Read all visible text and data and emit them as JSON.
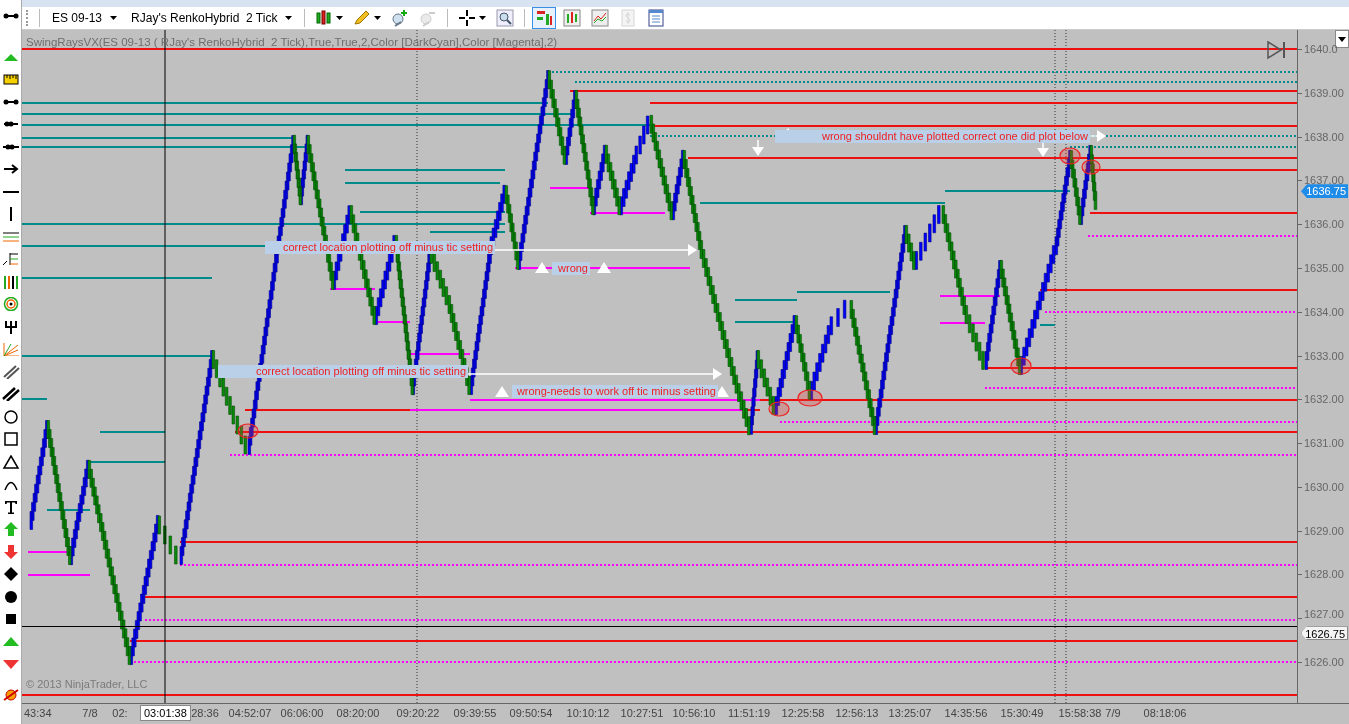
{
  "toolbar": {
    "instrument": "ES 09-13",
    "bar_type": "RJay's RenkoHybrid  2 Tick",
    "buttons": [
      {
        "kind": "candles",
        "on": false,
        "disabled": false
      },
      {
        "kind": "pencil",
        "on": false,
        "disabled": false
      },
      {
        "kind": "zoom-in",
        "on": false,
        "disabled": false
      },
      {
        "kind": "zoom-out",
        "on": false,
        "disabled": true
      },
      {
        "kind": "crosshair",
        "on": false,
        "disabled": false
      },
      {
        "kind": "find",
        "on": false,
        "disabled": false
      },
      {
        "kind": "data-box",
        "on": true,
        "disabled": false
      },
      {
        "kind": "bars",
        "on": false,
        "disabled": false
      },
      {
        "kind": "line-chart",
        "on": false,
        "disabled": false
      },
      {
        "kind": "dollar",
        "on": false,
        "disabled": true
      },
      {
        "kind": "properties",
        "on": false,
        "disabled": false
      }
    ]
  },
  "chart": {
    "indicator_label": "SwingRaysVX(ES 09-13 ( RJay's RenkoHybrid  2 Tick),True,True,2,Color [DarkCyan],Color [Magenta],2)",
    "copyright": "© 2013 NinjaTrader, LLC",
    "annotations": [
      "wrong shouldnt have plotted correct one did plot below",
      "correct location plotting off minus tic setting",
      "wrong",
      "correct location plotting off minus tic setting",
      "wrong-needs to work off tic minus setting"
    ],
    "price_axis": {
      "labels": [
        "1640.0",
        "1639.00",
        "1638.00",
        "1637.00",
        "1636.00",
        "1635.00",
        "1634.00",
        "1633.00",
        "1632.00",
        "1631.00",
        "1630.00",
        "1629.00",
        "1628.00",
        "1627.00",
        "1626.00"
      ],
      "last_price": "1636.75",
      "crosshair_price": "1626.75"
    },
    "time_axis": {
      "labels": [
        "43:34",
        "7/8",
        "02:",
        "28:36",
        "04:52:07",
        "06:06:00",
        "08:20:00",
        "09:20:22",
        "09:39:55",
        "09:50:54",
        "10:10:12",
        "10:27:51",
        "10:56:10",
        "11:51:19",
        "12:25:58",
        "12:56:13",
        "13:25:07",
        "14:35:56",
        "15:30:49",
        "15:58:38",
        "7/9",
        "08:18:06"
      ],
      "crosshair_time": "03:01:38"
    }
  }
}
